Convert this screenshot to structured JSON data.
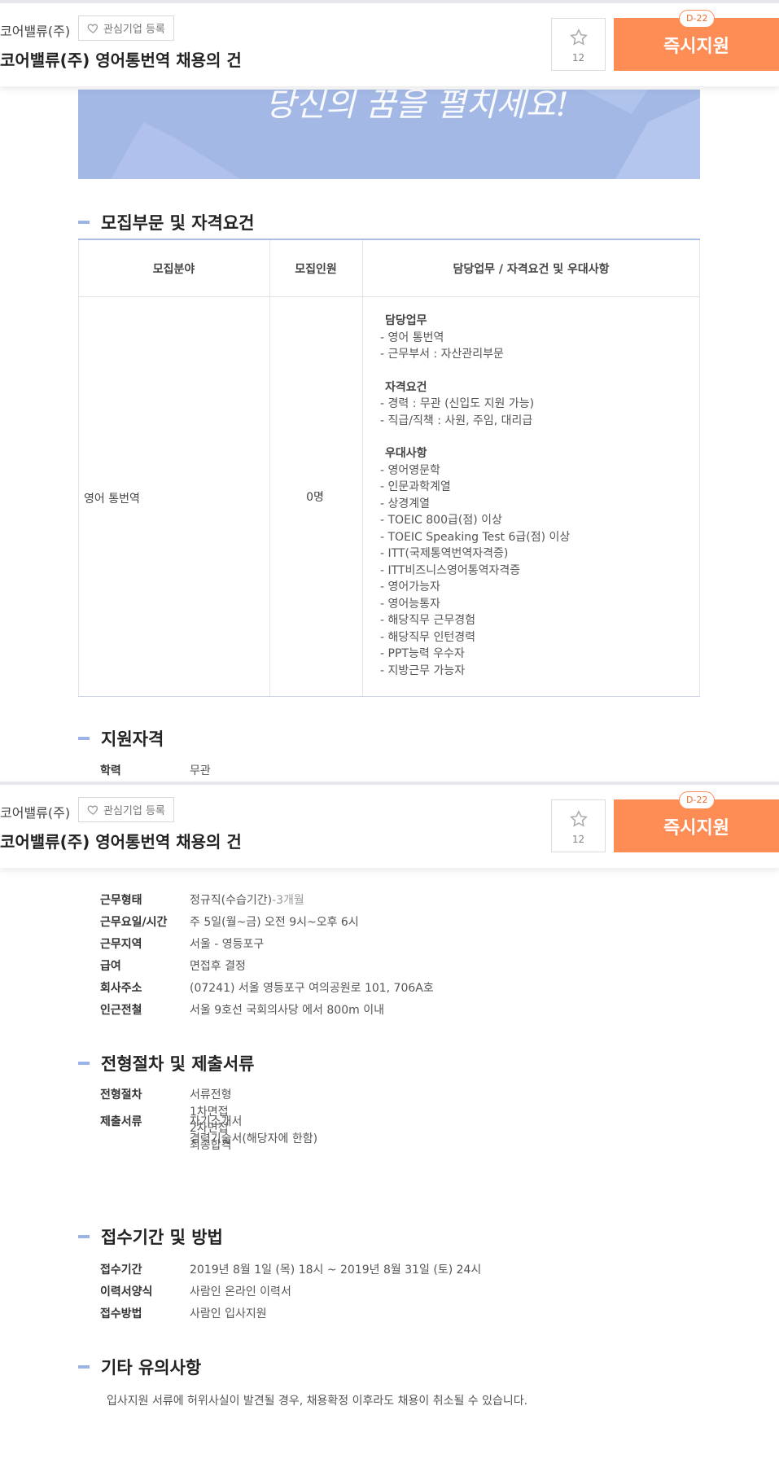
{
  "header": {
    "company": "코어밸류(주)",
    "favorite_label": "관심기업 등록",
    "title": "코어밸류(주) 영어통번역 채용의 건",
    "scrap_count": "12",
    "apply_label": "즉시지원",
    "dday": "D-22"
  },
  "banner": {
    "slogan": "당신의 꿈을 펼치세요!"
  },
  "sections": {
    "recruit": "모집부문 및 자격요건",
    "qualification": "지원자격",
    "process": "전형절차 및 제출서류",
    "period": "접수기간 및 방법",
    "etc": "기타 유의사항"
  },
  "table": {
    "headers": [
      "모집분야",
      "모집인원",
      "담당업무 / 자격요건 및 우대사항"
    ],
    "field": "영어 통번역",
    "count": "0명",
    "duty_title": "담당업무",
    "duties": [
      "- 영어 통번역",
      "- 근무부서 : 자산관리부문"
    ],
    "qual_title": "자격요건",
    "quals": [
      "- 경력 : 무관 (신입도 지원 가능)",
      "- 직급/직책 : 사원, 주임, 대리급"
    ],
    "pref_title": "우대사항",
    "prefs": [
      "- 영어영문학",
      "- 인문과학계열",
      "- 상경계열",
      "- TOEIC 800급(점) 이상",
      "- TOEIC Speaking Test 6급(점) 이상",
      "- ITT(국제통역번역자격증)",
      "- ITT비즈니스영어통역자격증",
      "- 영어가능자",
      "- 영어능통자",
      "- 해당직무 근무경험",
      "- 해당직무 인턴경력",
      "- PPT능력 우수자",
      "- 지방근무 가능자"
    ]
  },
  "qualification": {
    "edu_label": "학력",
    "edu_value": "무관"
  },
  "conditions": {
    "type_label": "근무형태",
    "type_value": "정규직(수습기간)",
    "type_extra": "-3개월",
    "hours_label": "근무요일/시간",
    "hours_value": "주 5일(월~금) 오전 9시~오후 6시",
    "region_label": "근무지역",
    "region_value": "서울 - 영등포구",
    "salary_label": "급여",
    "salary_value": "면접후 결정",
    "address_label": "회사주소",
    "address_value": "(07241) 서울 영등포구 여의공원로 101, 706A호",
    "station_label": "인근전철",
    "station_value": "서울 9호선 국회의사당 에서 800m 이내"
  },
  "process": {
    "steps_label": "전형절차",
    "steps": [
      "서류전형",
      "1차면접",
      "2차면접",
      "최종합격"
    ],
    "docs_label": "제출서류",
    "docs": [
      "자기소개서",
      "경력기술서(해당자에 한함)"
    ]
  },
  "period": {
    "period_label": "접수기간",
    "period_value": "2019년 8월 1일 (목) 18시 ~ 2019년 8월 31일 (토) 24시",
    "form_label": "이력서양식",
    "form_value": "사람인 온라인 이력서",
    "method_label": "접수방법",
    "method_value": "사람인 입사지원"
  },
  "etc": {
    "note": "입사지원 서류에 허위사실이 발견될 경우, 채용확정 이후라도 채용이 취소될 수 있습니다."
  },
  "colors": {
    "accent": "#fd8c55",
    "section_bar": "#9bb3e8",
    "banner": "#a4b8e6"
  }
}
